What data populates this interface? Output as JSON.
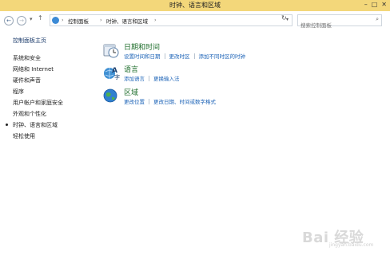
{
  "window": {
    "title": "时钟、语言和区域"
  },
  "address_bar": {
    "crumbs": [
      "控制面板",
      "时钟、语言和区域"
    ]
  },
  "search": {
    "placeholder": "搜索控制面板"
  },
  "sidebar": {
    "items": [
      {
        "label": "控制面板主页"
      },
      {
        "label": "系统和安全"
      },
      {
        "label": "网络和 Internet"
      },
      {
        "label": "硬件和声音"
      },
      {
        "label": "程序"
      },
      {
        "label": "用户帐户和家庭安全"
      },
      {
        "label": "外观和个性化"
      },
      {
        "label": "时钟、语言和区域",
        "selected": true
      },
      {
        "label": "轻松使用"
      }
    ]
  },
  "categories": [
    {
      "title": "日期和时间",
      "icon": "clock-icon",
      "links": [
        "设置时间和日期",
        "更改时区",
        "添加不同时区的时钟"
      ]
    },
    {
      "title": "语言",
      "icon": "language-icon",
      "links": [
        "添加语言",
        "更换输入法"
      ]
    },
    {
      "title": "区域",
      "icon": "globe-icon",
      "links": [
        "更改位置",
        "更改日期、时间或数字格式"
      ]
    }
  ],
  "watermark": {
    "text": "Bai 经验",
    "sub": "jingyan.baidu.com"
  },
  "colors": {
    "titlebar": "#f3d77a",
    "link": "#1c63b7",
    "category_title": "#1f6e2c"
  }
}
